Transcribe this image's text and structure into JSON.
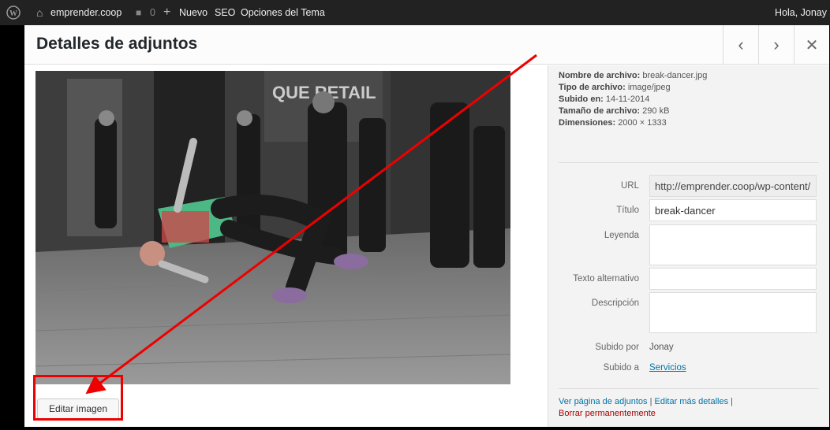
{
  "adminbar": {
    "site": "emprender.coop",
    "comments": "0",
    "new": "Nuevo",
    "seo": "SEO",
    "theme_options": "Opciones del Tema",
    "greeting": "Hola, Jonay"
  },
  "modal": {
    "title": "Detalles de adjuntos",
    "prev": "‹",
    "next": "›",
    "close": "✕",
    "edit_image": "Editar imagen"
  },
  "meta": {
    "filename_label": "Nombre de archivo:",
    "filename": "break-dancer.jpg",
    "filetype_label": "Tipo de archivo:",
    "filetype": "image/jpeg",
    "uploaded_label": "Subido en:",
    "uploaded": "14-11-2014",
    "size_label": "Tamaño de archivo:",
    "size": "290 kB",
    "dims_label": "Dimensiones:",
    "dims": "2000 × 1333"
  },
  "fields": {
    "url_label": "URL",
    "url": "http://emprender.coop/wp-content/",
    "title_label": "Título",
    "title": "break-dancer",
    "caption_label": "Leyenda",
    "alt_label": "Texto alternativo",
    "desc_label": "Descripción",
    "uploaded_by_label": "Subido por",
    "uploaded_by": "Jonay",
    "uploaded_to_label": "Subido a",
    "uploaded_to": "Servicios"
  },
  "links": {
    "view": "Ver página de adjuntos",
    "sep1": " | ",
    "edit": "Editar más detalles",
    "sep2": " |",
    "delete": "Borrar permanentemente"
  },
  "colors": {
    "annotation": "#e00000",
    "link": "#0073aa",
    "delete": "#aa0000"
  }
}
